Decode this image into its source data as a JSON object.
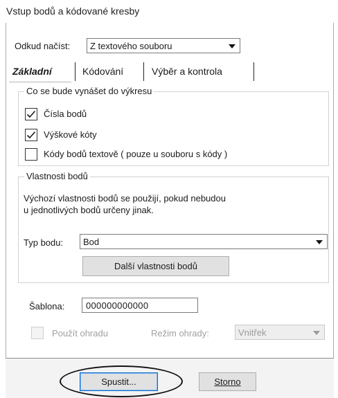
{
  "window": {
    "title": "Vstup bodů a kódované kresby"
  },
  "source": {
    "label": "Odkud načíst:",
    "value": "Z textového souboru",
    "arrow_icon": "chevron-down-icon"
  },
  "tabs": [
    {
      "label": "Základní",
      "active": true
    },
    {
      "label": "Kódování",
      "active": false
    },
    {
      "label": "Výběr a kontrola",
      "active": false
    }
  ],
  "plot_group": {
    "title": "Co se bude vynášet do výkresu",
    "options": [
      {
        "label": "Čísla bodů",
        "checked": true
      },
      {
        "label": "Výškové kóty",
        "checked": true
      },
      {
        "label": "Kódy bodů textově ( pouze u souboru s kódy )",
        "checked": false
      }
    ]
  },
  "point_props": {
    "title": "Vlastnosti bodů",
    "description_line1": "Výchozí vlastnosti bodů se použijí, pokud nebudou",
    "description_line2": "u jednotlivých bodů určeny jinak.",
    "type_label": "Typ bodu:",
    "type_value": "Bod",
    "more_button": "Další vlastnosti bodů"
  },
  "template": {
    "label": "Šablona:",
    "value": "000000000000"
  },
  "fence": {
    "use_label": "Použít ohradu",
    "use_checked": false,
    "mode_label": "Režim ohrady:",
    "mode_value": "Vnitřek"
  },
  "buttons": {
    "run": "Spustit...",
    "cancel": "Storno"
  },
  "colors": {
    "check": "#1a1a1a",
    "primary_border": "#0a6ed1",
    "disabled_text": "#a0a0a0"
  }
}
